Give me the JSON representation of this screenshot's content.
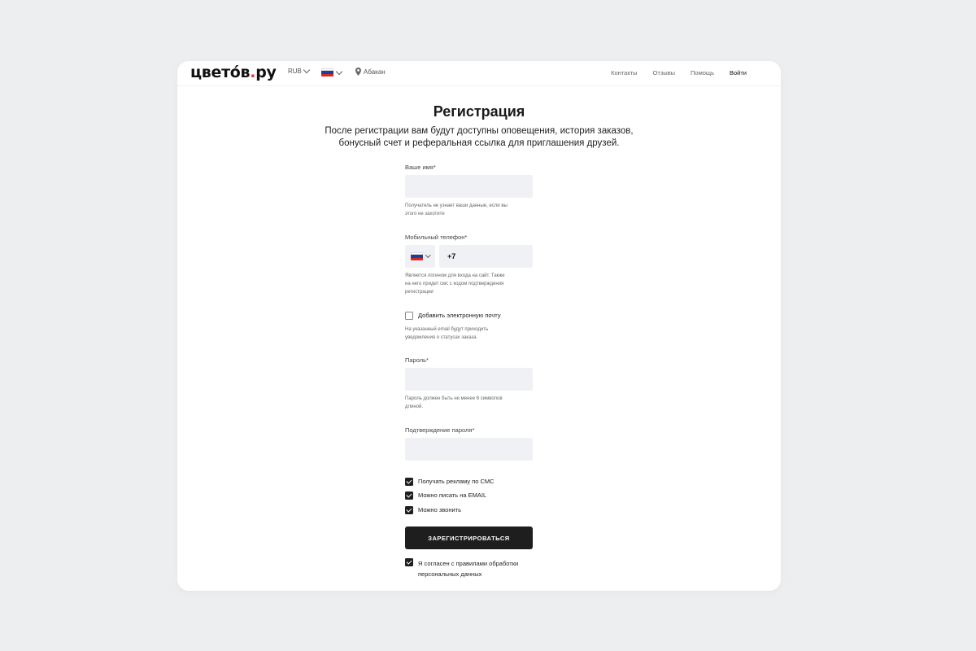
{
  "header": {
    "logo_main": "цветóв",
    "logo_dot": ".",
    "logo_tld": "ру",
    "currency": "RUB",
    "language_flag": "ru-flag",
    "city": "Абакан",
    "nav": [
      "Контакты",
      "Отзывы",
      "Помощь",
      "Войти"
    ]
  },
  "page": {
    "title": "Регистрация",
    "subtitle_line1": "После регистрации вам будут доступны оповещения, история заказов,",
    "subtitle_line2": "бонусный счет и реферальная ссылка для приглашения друзей."
  },
  "form": {
    "name": {
      "label": "Ваше имя*",
      "value": "",
      "hint_line1": "Получатель не узнает ваши данные, если вы",
      "hint_line2": "этого не захотите"
    },
    "phone": {
      "label": "Мобильный телефон*",
      "country_flag": "ru-flag",
      "value": "+7",
      "hint_line1": "Является логином для входа на сайт. Также",
      "hint_line2": "на него придет смс с кодом подтверждения",
      "hint_line3": "регистрации"
    },
    "email_toggle": {
      "label": "Добавить электронную почту",
      "checked": false,
      "hint_line1": "На указанный email будут приходить",
      "hint_line2": "уведомления о статусах заказа"
    },
    "password": {
      "label": "Пароль*",
      "value": "",
      "hint_line1": "Пароль должен быть не менее 6 символов",
      "hint_line2": "длиной."
    },
    "password_confirm": {
      "label": "Подтверждение пароля*",
      "value": ""
    },
    "consents": [
      {
        "label": "Получать рекламу по СМС",
        "checked": true
      },
      {
        "label": "Можно писать на EMAIL",
        "checked": true
      },
      {
        "label": "Можно звонить",
        "checked": true
      }
    ],
    "submit_label": "ЗАРЕГИСТРИРОВАТЬСЯ",
    "agreement": {
      "checked": true,
      "line1": "Я согласен с правилами обработки",
      "line2": "персональных данных"
    }
  },
  "colors": {
    "background": "#eceef0",
    "card": "#ffffff",
    "input_bg": "#eff1f5",
    "accent_dot": "#e03a45",
    "button": "#1e1e1e"
  }
}
